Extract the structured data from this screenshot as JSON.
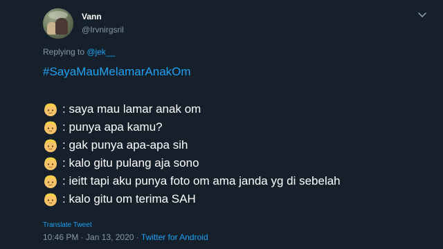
{
  "author": {
    "name": "Vann",
    "handle": "@Irvnirgsril"
  },
  "header": {
    "menu_icon": "chevron-down-icon"
  },
  "reply": {
    "prefix": "Replying to ",
    "mention": "@jek__"
  },
  "tweet": {
    "hashtag": "#SayaMauMelamarAnakOm",
    "emoji_icon": "blond-person-emoji-icon",
    "lines": [
      ": saya mau lamar anak om",
      ": punya apa kamu?",
      ": gak punya apa-apa sih",
      ": kalo gitu pulang aja sono",
      ": ieitt tapi aku punya foto om ama janda yg di sebelah",
      ": kalo gitu om terima SAH"
    ]
  },
  "footer": {
    "translate_label": "Translate Tweet",
    "time": "10:46 PM",
    "separator": " · ",
    "date": "Jan 13, 2020",
    "source": "Twitter for Android"
  },
  "colors": {
    "background": "#15202b",
    "accent": "#1da1f2",
    "muted": "#8899a6",
    "text": "#ffffff"
  }
}
